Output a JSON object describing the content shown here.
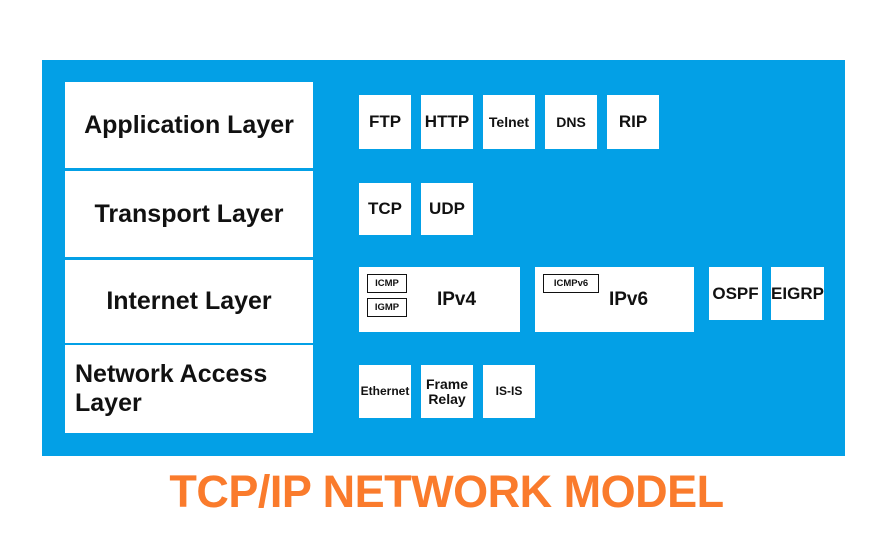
{
  "title": "TCP/IP NETWORK MODEL",
  "colors": {
    "panel_background": "#03A0E6",
    "box_background": "#FFFFFF",
    "text": "#111111",
    "title": "#FA7B2C",
    "page_background": "#FFFFFF"
  },
  "layers": [
    {
      "name": "Application Layer",
      "align": "center"
    },
    {
      "name": "Transport Layer",
      "align": "center"
    },
    {
      "name": "Internet Layer",
      "align": "center"
    },
    {
      "name": "Network Access Layer",
      "align": "left"
    }
  ],
  "protocol_rows": {
    "application": [
      {
        "label": "FTP"
      },
      {
        "label": "HTTP"
      },
      {
        "label": "Telnet"
      },
      {
        "label": "DNS"
      },
      {
        "label": "RIP"
      }
    ],
    "transport": [
      {
        "label": "TCP"
      },
      {
        "label": "UDP"
      }
    ],
    "internet": {
      "ip_groups": [
        {
          "label": "IPv4",
          "sub_protocols": [
            "ICMP",
            "IGMP"
          ]
        },
        {
          "label": "IPv6",
          "sub_protocols": [
            "ICMPv6"
          ]
        }
      ],
      "routing_protocols": [
        {
          "label": "OSPF"
        },
        {
          "label": "EIGRP"
        }
      ]
    },
    "network_access": [
      {
        "label": "Ethernet"
      },
      {
        "label": "Frame Relay"
      },
      {
        "label": "IS-IS"
      }
    ]
  }
}
